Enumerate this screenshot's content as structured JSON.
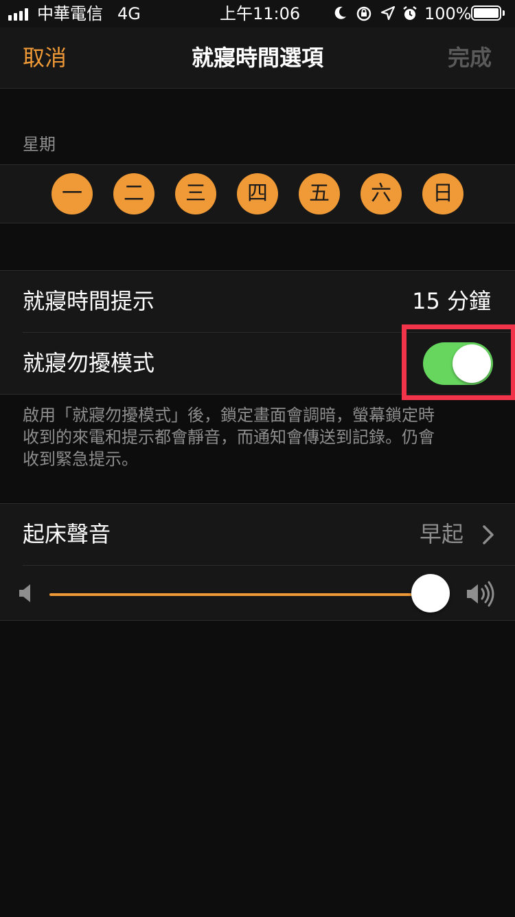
{
  "status_bar": {
    "carrier": "中華電信",
    "network": "4G",
    "time": "上午11:06",
    "battery": "100%",
    "icons": [
      "signal-icon",
      "moon-icon",
      "orientation-lock-icon",
      "location-icon",
      "alarm-icon",
      "battery-icon"
    ]
  },
  "nav": {
    "cancel": "取消",
    "title": "就寢時間選項",
    "done": "完成"
  },
  "days": {
    "label": "星期",
    "items": [
      "一",
      "二",
      "三",
      "四",
      "五",
      "六",
      "日"
    ]
  },
  "settings": {
    "reminder_label": "就寢時間提示",
    "reminder_value": "15 分鐘",
    "dnd_label": "就寢勿擾模式",
    "dnd_enabled": true,
    "footer_lines": [
      "啟用「就寢勿擾模式」後，鎖定畫面會調暗，螢幕鎖定時",
      "收到的來電和提示都會靜音，而通知會傳送到記錄。仍會",
      "收到緊急提示。"
    ]
  },
  "wake": {
    "sound_label": "起床聲音",
    "sound_value": "早起",
    "volume_level": 1.0
  },
  "colors": {
    "accent": "#f09a37",
    "toggle_on": "#66d65e",
    "highlight": "#f2344b",
    "background": "#0d0d0d",
    "cell": "#171717",
    "secondary_text": "#8e8e8e"
  }
}
